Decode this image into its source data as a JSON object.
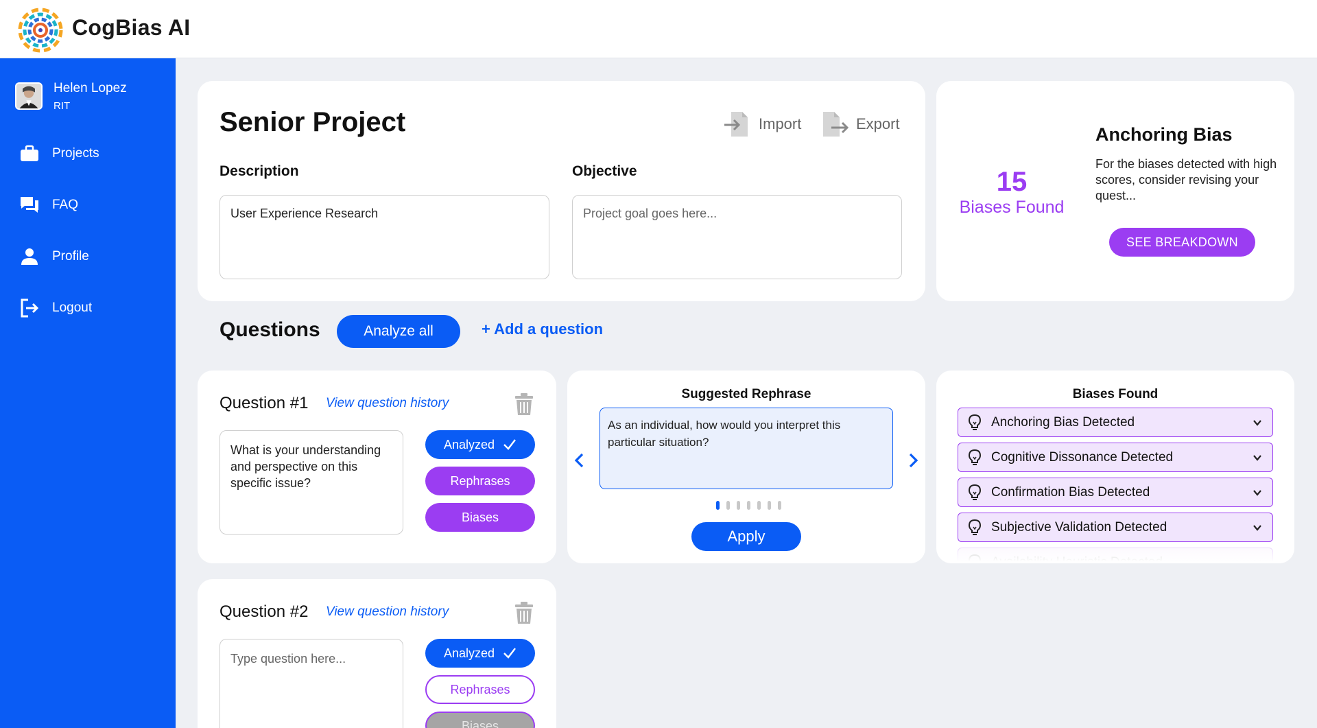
{
  "app": {
    "title": "CogBias AI"
  },
  "user": {
    "name": "Helen Lopez",
    "org": "RIT"
  },
  "nav": [
    {
      "label": "Projects",
      "icon": "briefcase-icon"
    },
    {
      "label": "FAQ",
      "icon": "chat-icon"
    },
    {
      "label": "Profile",
      "icon": "person-icon"
    },
    {
      "label": "Logout",
      "icon": "logout-icon"
    }
  ],
  "project": {
    "title": "Senior Project",
    "import_label": "Import",
    "export_label": "Export",
    "description_label": "Description",
    "description_value": "User Experience Research",
    "objective_label": "Objective",
    "objective_placeholder": "Project goal goes here..."
  },
  "bias_summary": {
    "count": "15",
    "count_label": "Biases Found",
    "title": "Anchoring Bias",
    "description": "For the biases detected with high scores, consider revising your quest...",
    "button": "SEE BREAKDOWN"
  },
  "questions_section": {
    "heading": "Questions",
    "analyze_all": "Analyze all",
    "add_question": "+ Add a question"
  },
  "questions": [
    {
      "title": "Question #1",
      "history_link": "View question history",
      "text": "What is your understanding and perspective on this specific issue?",
      "placeholder": "",
      "analyzed": "Analyzed",
      "rephrases": "Rephrases",
      "biases": "Biases"
    },
    {
      "title": "Question #2",
      "history_link": "View question history",
      "text": "",
      "placeholder": "Type question here...",
      "analyzed": "Analyzed",
      "rephrases": "Rephrases",
      "biases": "Biases"
    }
  ],
  "rephrase": {
    "heading": "Suggested Rephrase",
    "text": "As an individual, how would you interpret this particular situation?",
    "page_count": 7,
    "current_page": 1,
    "apply": "Apply"
  },
  "biases_found": {
    "heading": "Biases Found",
    "items": [
      "Anchoring Bias Detected",
      "Cognitive Dissonance Detected",
      "Confirmation Bias Detected",
      "Subjective Validation Detected",
      "Availability Heuristic Detected"
    ]
  },
  "colors": {
    "primary": "#0a5cf5",
    "accent": "#9b3df2",
    "background": "#eef0f4"
  }
}
